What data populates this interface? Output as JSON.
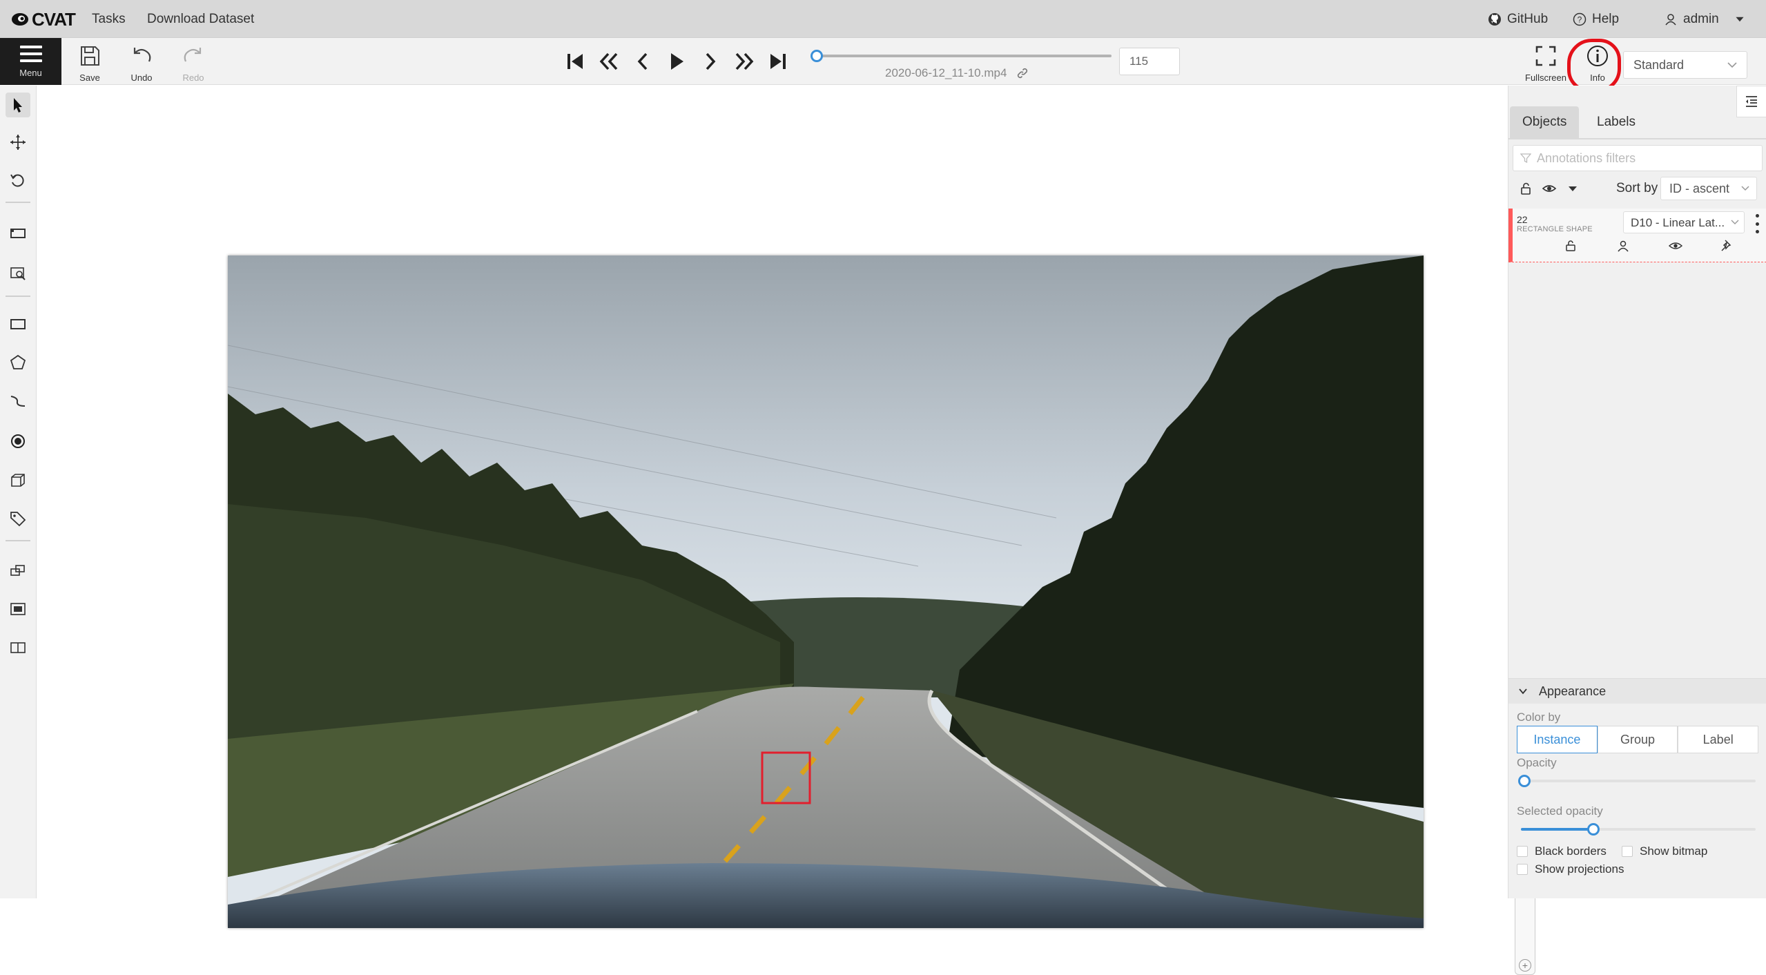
{
  "header": {
    "logo_text": "CVAT",
    "nav": [
      "Tasks",
      "Download Dataset"
    ],
    "github": "GitHub",
    "help": "Help",
    "user": "admin"
  },
  "toolbar": {
    "menu_label": "Menu",
    "save_label": "Save",
    "undo_label": "Undo",
    "redo_label": "Redo",
    "filename": "2020-06-12_11-10.mp4",
    "frame_number": "115",
    "frame_position_fraction": 0,
    "fullscreen_label": "Fullscreen",
    "info_label": "Info",
    "workspace": "Standard"
  },
  "left_tools": [
    "cursor-icon",
    "move-icon",
    "rotate-icon",
    "fit-icon",
    "zoom-region-icon",
    "rectangle-icon",
    "polygon-icon",
    "polyline-icon",
    "points-icon",
    "cuboid-icon",
    "tag-icon",
    "merge-icon",
    "group-icon",
    "split-icon"
  ],
  "sidebar": {
    "tabs": [
      "Objects",
      "Labels"
    ],
    "filter_placeholder": "Annotations filters",
    "sort_label": "Sort by",
    "sort_value": "ID - ascent",
    "object": {
      "id": "22",
      "type": "RECTANGLE SHAPE",
      "label": "D10 - Linear Lat...",
      "color": "#ff5a5a"
    },
    "appearance": {
      "title": "Appearance",
      "color_by_label": "Color by",
      "color_by_options": [
        "Instance",
        "Group",
        "Label"
      ],
      "color_by_selected": "Instance",
      "opacity_label": "Opacity",
      "opacity_fraction": 0.0,
      "selected_opacity_label": "Selected opacity",
      "selected_opacity_fraction": 0.2,
      "black_borders": "Black borders",
      "show_bitmap": "Show bitmap",
      "show_projections": "Show projections"
    }
  },
  "colors": {
    "accent": "#3a8fd8",
    "highlight": "#e4111a"
  }
}
